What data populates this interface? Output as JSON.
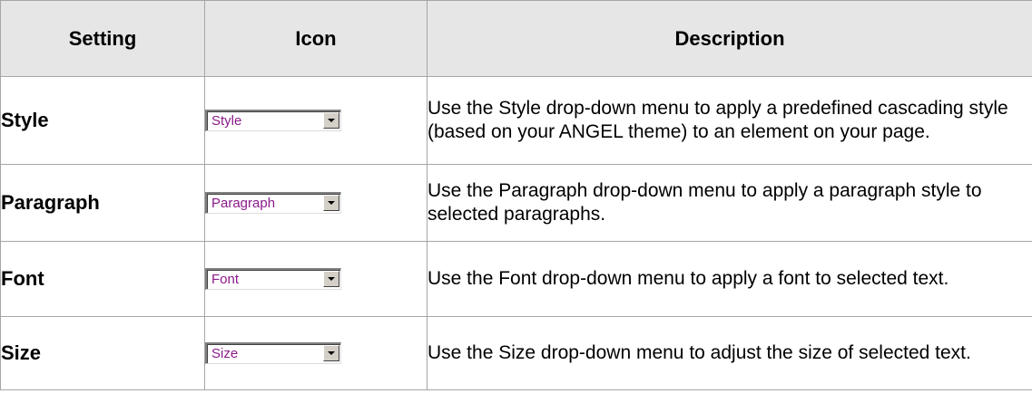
{
  "table": {
    "headers": {
      "setting": "Setting",
      "icon": "Icon",
      "description": "Description"
    },
    "rows": [
      {
        "setting": "Style",
        "icon_value": "Style",
        "description": "Use the Style drop-down menu to apply a predefined cascading style (based on your ANGEL theme) to an element on your page."
      },
      {
        "setting": "Paragraph",
        "icon_value": "Paragraph",
        "description": "Use the Paragraph drop-down menu to apply a paragraph style to selected paragraphs."
      },
      {
        "setting": "Font",
        "icon_value": "Font",
        "description": "Use the Font drop-down menu to apply a font to selected text."
      },
      {
        "setting": "Size",
        "icon_value": "Size",
        "description": "Use the Size drop-down menu to adjust the size of selected text."
      }
    ]
  },
  "colors": {
    "header_background": "#e6e6e6",
    "border": "#a6a6a6",
    "combo_text": "#8a1a8a",
    "combo_button": "#d4d0c8"
  },
  "icons": {
    "combo_arrow": "chevron-down-icon"
  }
}
